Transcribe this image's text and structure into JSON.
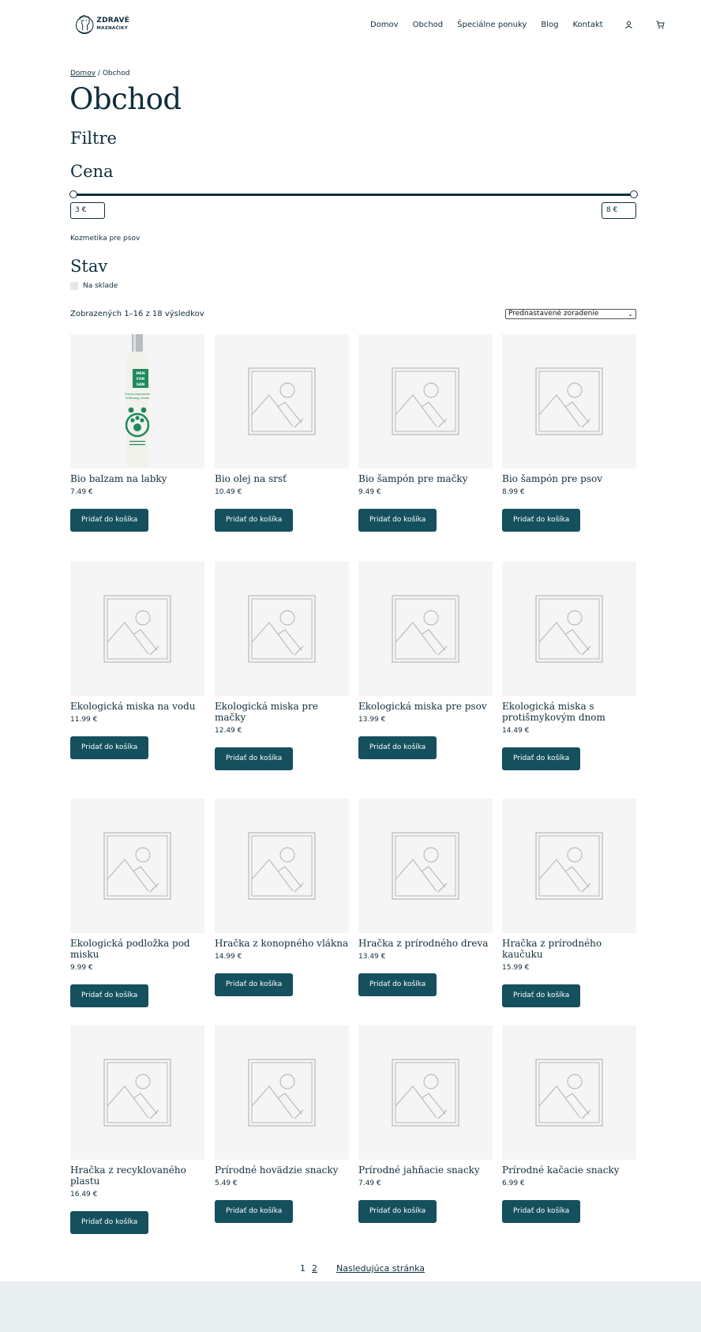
{
  "header": {
    "logo_line1": "ZDRAVÉ",
    "logo_line2": "MAZNÁČIKY",
    "nav": [
      "Domov",
      "Obchod",
      "Špeciálne ponuky",
      "Blog",
      "Kontakt"
    ]
  },
  "breadcrumb": {
    "home": "Domov",
    "separator": " / ",
    "current": "Obchod"
  },
  "page_title": "Obchod",
  "filters": {
    "heading": "Filtre",
    "price_heading": "Cena",
    "price_min": "3 €",
    "price_max": "8 €",
    "category": "Kozmetika pre psov",
    "status_heading": "Stav",
    "in_stock_label": "Na sklade"
  },
  "results_text": "Zobrazených 1–16 z 18 výsledkov",
  "sort_selected": "Prednastavené zoradenie",
  "add_to_cart": "Pridať do košíka",
  "products": [
    {
      "name": "Bio balzam na labky",
      "price": "7.49 €"
    },
    {
      "name": "Bio olej na srsť",
      "price": "10.49 €"
    },
    {
      "name": "Bio šampón pre mačky",
      "price": "9.49 €"
    },
    {
      "name": "Bio šampón pre psov",
      "price": "8.99 €"
    },
    {
      "name": "Ekologická miska na vodu",
      "price": "11.99 €"
    },
    {
      "name": "Ekologická miska pre mačky",
      "price": "12.49 €"
    },
    {
      "name": "Ekologická miska pre psov",
      "price": "13.99 €"
    },
    {
      "name": "Ekologická miska s protišmykovým dnom",
      "price": "14.49 €"
    },
    {
      "name": "Ekologická podložka pod misku",
      "price": "9.99 €"
    },
    {
      "name": "Hračka z konopného vlákna",
      "price": "14.99 €"
    },
    {
      "name": "Hračka z prírodného dreva",
      "price": "13.49 €"
    },
    {
      "name": "Hračka z prírodného kaučuku",
      "price": "15.99 €"
    },
    {
      "name": "Hračka z recyklovaného plastu",
      "price": "16.49 €"
    },
    {
      "name": "Prírodné hovädzie snacky",
      "price": "5.49 €"
    },
    {
      "name": "Prírodné jahňacie snacky",
      "price": "7.49 €"
    },
    {
      "name": "Prírodné kačacie snacky",
      "price": "6.99 €"
    }
  ],
  "product_bottle": {
    "brand": "MEN FOR SAN",
    "text": "Crema suavizante Softening cream"
  },
  "pagination": {
    "current": "1",
    "page2": "2",
    "next": "Nasledujúca stránka"
  },
  "colors": {
    "primary": "#0f2e3c",
    "button": "#15505f",
    "image_bg": "#f4f5f4",
    "footer": "#e9eef0"
  }
}
